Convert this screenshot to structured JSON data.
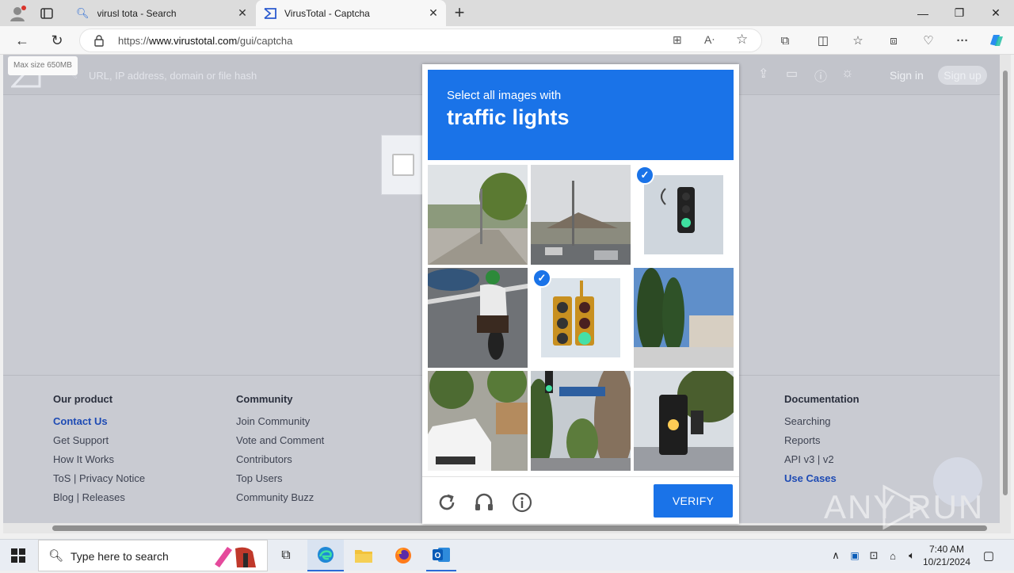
{
  "browser": {
    "tabs": [
      {
        "label": "virusl tota - Search",
        "active": false
      },
      {
        "label": "VirusTotal - Captcha",
        "active": true
      }
    ],
    "url_prefix": "https://",
    "url_host": "www.virustotal.com",
    "url_path": "/gui/captcha"
  },
  "vt": {
    "tooltip": "Max size 650MB",
    "search_placeholder": "URL, IP address, domain or file hash",
    "sign_in": "Sign in",
    "sign_up": "Sign up"
  },
  "footer": {
    "our_product": {
      "heading": "Our product",
      "links": [
        "Contact Us",
        "Get Support",
        "How It Works",
        "ToS | Privacy Notice",
        "Blog | Releases"
      ]
    },
    "community": {
      "heading": "Community",
      "links": [
        "Join Community",
        "Vote and Comment",
        "Contributors",
        "Top Users",
        "Community Buzz"
      ]
    },
    "documentation": {
      "heading": "Documentation",
      "links": [
        "Searching",
        "Reports",
        "API v3 | v2",
        "Use Cases"
      ]
    }
  },
  "captcha": {
    "prompt": "Select all images with",
    "target": "traffic lights",
    "verify_label": "VERIFY",
    "selected_tiles": [
      3,
      5
    ],
    "accent": "#1a73e8"
  },
  "watermark": "ANY RUN",
  "taskbar": {
    "search_placeholder": "Type here to search",
    "time": "7:40 AM",
    "date": "10/21/2024"
  }
}
